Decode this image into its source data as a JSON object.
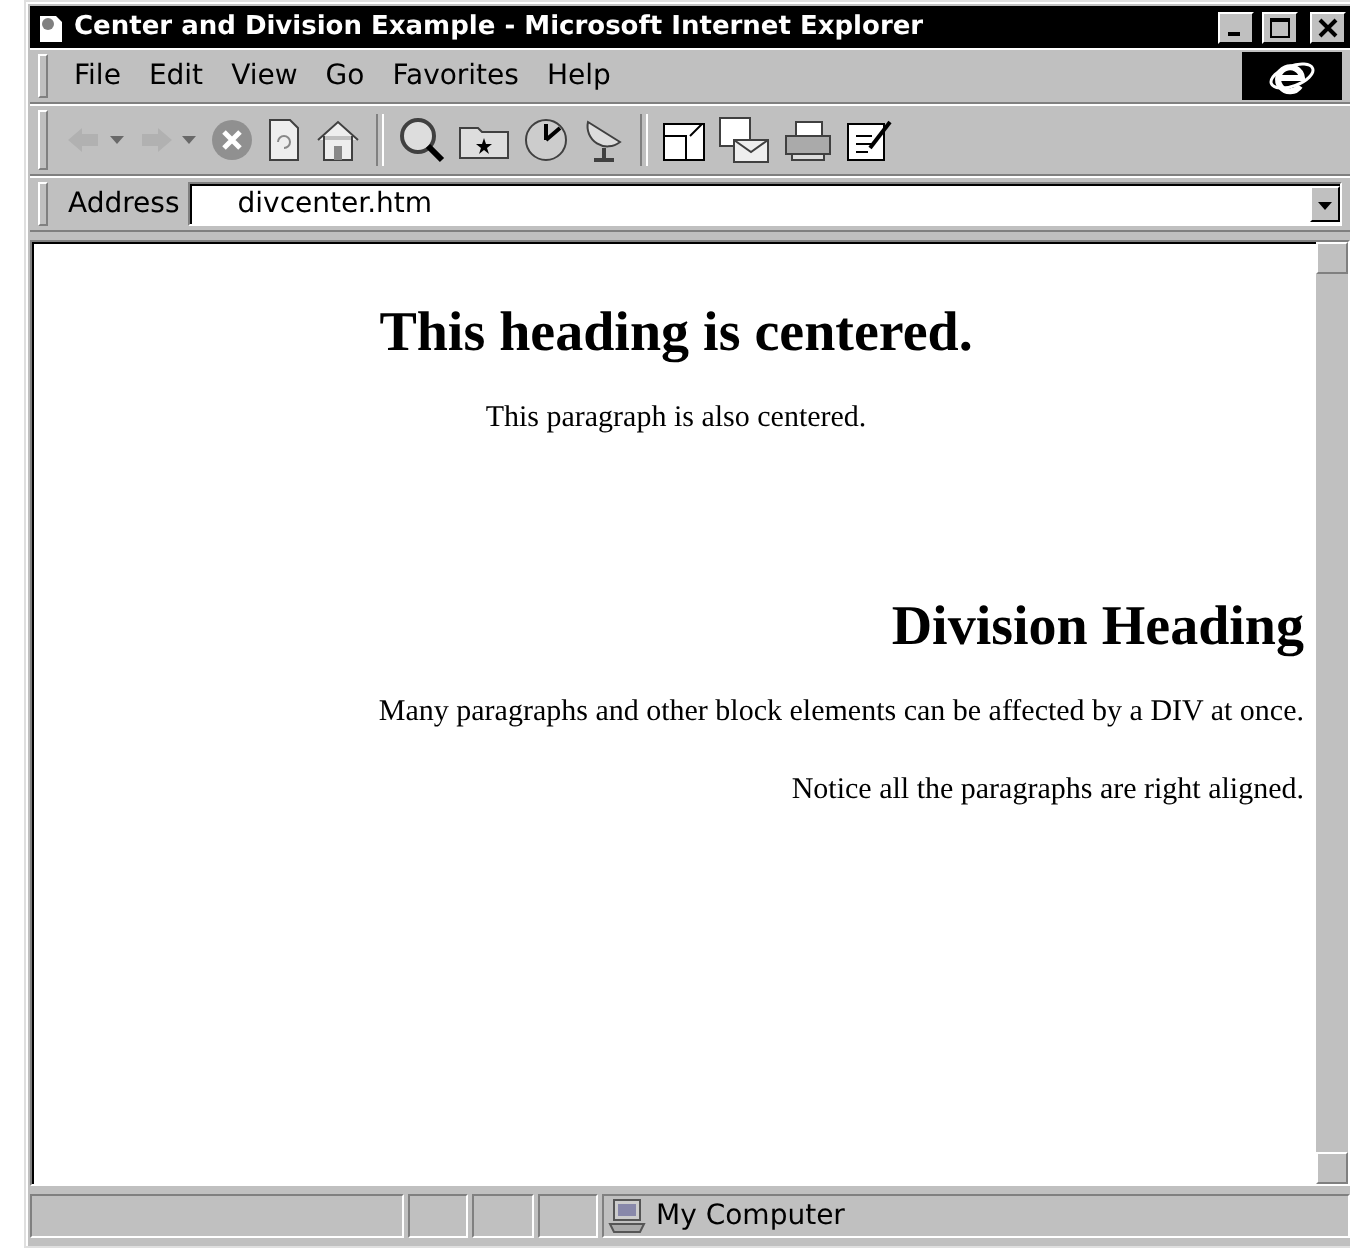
{
  "window": {
    "title": "Center and Division Example - Microsoft Internet Explorer"
  },
  "menu": [
    "File",
    "Edit",
    "View",
    "Go",
    "Favorites",
    "Help"
  ],
  "toolbar": [
    [
      {
        "kind": "back",
        "disabled": true
      },
      {
        "kind": "forward",
        "disabled": true
      },
      {
        "kind": "stop",
        "disabled": false
      },
      {
        "kind": "refresh",
        "disabled": false
      },
      {
        "kind": "home",
        "disabled": false
      }
    ],
    [
      {
        "kind": "search",
        "disabled": false
      },
      {
        "kind": "favorites",
        "disabled": false
      },
      {
        "kind": "history",
        "disabled": false
      },
      {
        "kind": "channels",
        "disabled": false
      }
    ],
    [
      {
        "kind": "fullscreen",
        "disabled": false
      },
      {
        "kind": "mail",
        "disabled": false
      },
      {
        "kind": "print",
        "disabled": false
      },
      {
        "kind": "edit",
        "disabled": false
      }
    ]
  ],
  "address": {
    "label": "Address",
    "value": "divcenter.htm"
  },
  "centered": [
    {
      "kind": "heading",
      "text": "This heading is centered."
    },
    {
      "kind": "paragraph",
      "text": "This paragraph is also centered."
    }
  ],
  "division": [
    {
      "kind": "heading",
      "text": "Division Heading"
    },
    {
      "kind": "paragraph",
      "text": "Many paragraphs and other block elements can be affected by a DIV at once."
    },
    {
      "kind": "paragraph",
      "text": "Notice all the paragraphs are right aligned."
    }
  ],
  "status_bar": {
    "zone": "My Computer"
  }
}
